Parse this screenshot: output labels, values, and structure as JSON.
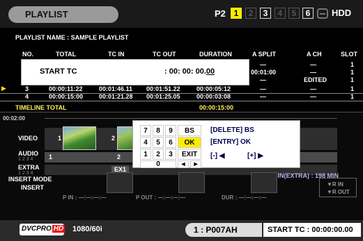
{
  "header": {
    "title": "PLAYLIST",
    "p2_label": "P2",
    "slots": [
      "1",
      "2",
      "3",
      "4",
      "5",
      "6"
    ],
    "hdd_label": "HDD"
  },
  "playlist_name": "PLAYLIST NAME  :  SAMPLE PLAYLIST",
  "columns": {
    "no": "NO.",
    "total": "TOTAL",
    "tc_in": "TC IN",
    "tc_out": "TC OUT",
    "duration": "DURATION",
    "a_split": "A SPLIT",
    "a_ch": "A CH",
    "slot": "SLOT"
  },
  "hidden_rows": {
    "r0_split": "—",
    "r0_ach": "—",
    "r0_slot": "1",
    "r1_split": "00:01:00",
    "r1_ach": "—",
    "r1_slot": "1",
    "r2_split": "—",
    "r2_ach": "EDITED",
    "r2_slot": "1"
  },
  "rows": [
    {
      "no": "3",
      "total": "00:00:11:22",
      "tc_in": "00:01:46.11",
      "tc_out": "00:01:51.22",
      "duration": "00:00:05:12",
      "a_split": "—",
      "a_ch": "—",
      "slot": "1"
    },
    {
      "no": "4",
      "total": "00:00:15:00",
      "tc_in": "00:01:21.28",
      "tc_out": "00:01:25.05",
      "duration": "00:00:03:08",
      "a_split": "—",
      "a_ch": "—",
      "slot": "1"
    }
  ],
  "timeline_total": {
    "label": "TIMELINE TOTAL",
    "value": "00:00:15:00"
  },
  "timeline": {
    "time_label": "00:02:00",
    "video_label": "VIDEO",
    "audio_label": "AUDIO",
    "audio_ch": "1 2 3 4",
    "extra_label": "EXTRA",
    "extra_ch": "1 2 3 4",
    "clip1": "1",
    "clip2": "2",
    "ex1": "EX1"
  },
  "start_tc_dialog": {
    "label": "START TC",
    "value_prefix": ":  00: 00: 00.",
    "value_last": "00"
  },
  "keypad": {
    "row1": [
      "7",
      "8",
      "9",
      "BS"
    ],
    "row2": [
      "4",
      "5",
      "6",
      "OK"
    ],
    "row3": [
      "1",
      "2",
      "3",
      "EXIT"
    ],
    "row4": [
      "0",
      "◂",
      "▸"
    ],
    "hint_delete": "[DELETE] BS",
    "hint_entry": "[ENTRY]  OK",
    "hint_minus": "[-] ◀",
    "hint_plus": "[+] ▶"
  },
  "remain": "REMAIN(EXTRA) : 198 MIN",
  "insert_mode": {
    "label": "INSERT MODE",
    "sub": "INSERT",
    "p_in": "P IN : —:—:—:—",
    "p_out": "P OUT : —:—:—:—",
    "dur": "DUR : —:—:—:—",
    "r_in": "▼R IN",
    "r_out": "▼R OUT"
  },
  "statusbar": {
    "codec": "DVCPRO",
    "codec_hd": "HD",
    "format": "1080/60i",
    "clip_id": "1 : P007AH",
    "start_tc": "START TC    : 00:00:00.00"
  },
  "colors": {
    "accent_yellow": "#ffea00",
    "remain_text": "#b7b3e8",
    "timeline_total": "#ffef5c"
  }
}
